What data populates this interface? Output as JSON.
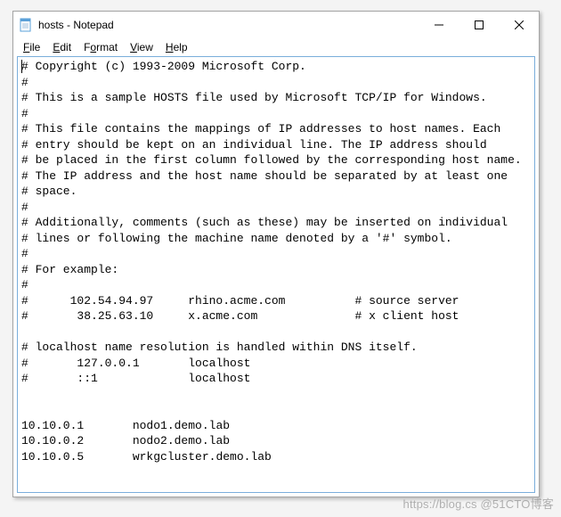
{
  "window": {
    "title": "hosts - Notepad"
  },
  "menus": {
    "file": "File",
    "edit": "Edit",
    "format": "Format",
    "view": "View",
    "help": "Help"
  },
  "content": "# Copyright (c) 1993-2009 Microsoft Corp.\n#\n# This is a sample HOSTS file used by Microsoft TCP/IP for Windows.\n#\n# This file contains the mappings of IP addresses to host names. Each\n# entry should be kept on an individual line. The IP address should\n# be placed in the first column followed by the corresponding host name.\n# The IP address and the host name should be separated by at least one\n# space.\n#\n# Additionally, comments (such as these) may be inserted on individual\n# lines or following the machine name denoted by a '#' symbol.\n#\n# For example:\n#\n#      102.54.94.97     rhino.acme.com          # source server\n#       38.25.63.10     x.acme.com              # x client host\n\n# localhost name resolution is handled within DNS itself.\n#\t127.0.0.1       localhost\n#\t::1             localhost\n\n\n10.10.0.1\tnodo1.demo.lab\n10.10.0.2\tnodo2.demo.lab\n10.10.0.5\twrkgcluster.demo.lab\n",
  "watermark": "https://blog.cs  @51CTO博客"
}
